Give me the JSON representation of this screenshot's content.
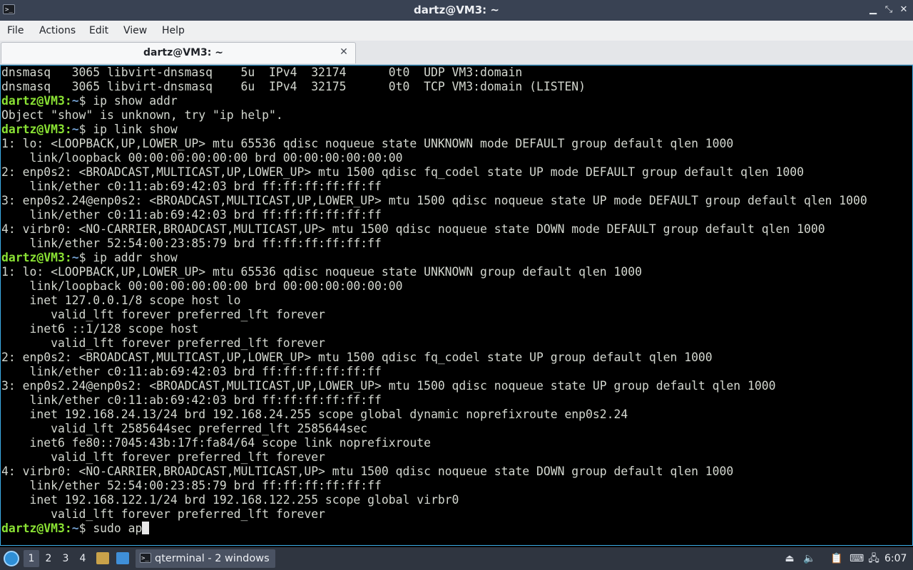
{
  "window": {
    "title": "dartz@VM3: ~",
    "controls": [
      "minimize",
      "restore",
      "close"
    ]
  },
  "menu": {
    "items": [
      "File",
      "Actions",
      "Edit",
      "View",
      "Help"
    ]
  },
  "tabs": [
    {
      "label": "dartz@VM3: ~",
      "close": "✕"
    }
  ],
  "terminal": {
    "prompt_user": "dartz@VM3",
    "prompt_sep": ":",
    "prompt_path": "~",
    "prompt_end": "$ ",
    "lines": [
      {
        "type": "out",
        "text": "dnsmasq   3065 libvirt-dnsmasq    5u  IPv4  32174      0t0  UDP VM3:domain"
      },
      {
        "type": "out",
        "text": "dnsmasq   3065 libvirt-dnsmasq    6u  IPv4  32175      0t0  TCP VM3:domain (LISTEN)"
      },
      {
        "type": "cmd",
        "text": "ip show addr"
      },
      {
        "type": "out",
        "text": "Object \"show\" is unknown, try \"ip help\"."
      },
      {
        "type": "cmd",
        "text": "ip link show"
      },
      {
        "type": "out",
        "text": "1: lo: <LOOPBACK,UP,LOWER_UP> mtu 65536 qdisc noqueue state UNKNOWN mode DEFAULT group default qlen 1000"
      },
      {
        "type": "out",
        "text": "    link/loopback 00:00:00:00:00:00 brd 00:00:00:00:00:00"
      },
      {
        "type": "out",
        "text": "2: enp0s2: <BROADCAST,MULTICAST,UP,LOWER_UP> mtu 1500 qdisc fq_codel state UP mode DEFAULT group default qlen 1000"
      },
      {
        "type": "out",
        "text": "    link/ether c0:11:ab:69:42:03 brd ff:ff:ff:ff:ff:ff"
      },
      {
        "type": "out",
        "text": "3: enp0s2.24@enp0s2: <BROADCAST,MULTICAST,UP,LOWER_UP> mtu 1500 qdisc noqueue state UP mode DEFAULT group default qlen 1000"
      },
      {
        "type": "out",
        "text": "    link/ether c0:11:ab:69:42:03 brd ff:ff:ff:ff:ff:ff"
      },
      {
        "type": "out",
        "text": "4: virbr0: <NO-CARRIER,BROADCAST,MULTICAST,UP> mtu 1500 qdisc noqueue state DOWN mode DEFAULT group default qlen 1000"
      },
      {
        "type": "out",
        "text": "    link/ether 52:54:00:23:85:79 brd ff:ff:ff:ff:ff:ff"
      },
      {
        "type": "cmd",
        "text": "ip addr show"
      },
      {
        "type": "out",
        "text": "1: lo: <LOOPBACK,UP,LOWER_UP> mtu 65536 qdisc noqueue state UNKNOWN group default qlen 1000"
      },
      {
        "type": "out",
        "text": "    link/loopback 00:00:00:00:00:00 brd 00:00:00:00:00:00"
      },
      {
        "type": "out",
        "text": "    inet 127.0.0.1/8 scope host lo"
      },
      {
        "type": "out",
        "text": "       valid_lft forever preferred_lft forever"
      },
      {
        "type": "out",
        "text": "    inet6 ::1/128 scope host"
      },
      {
        "type": "out",
        "text": "       valid_lft forever preferred_lft forever"
      },
      {
        "type": "out",
        "text": "2: enp0s2: <BROADCAST,MULTICAST,UP,LOWER_UP> mtu 1500 qdisc fq_codel state UP group default qlen 1000"
      },
      {
        "type": "out",
        "text": "    link/ether c0:11:ab:69:42:03 brd ff:ff:ff:ff:ff:ff"
      },
      {
        "type": "out",
        "text": "3: enp0s2.24@enp0s2: <BROADCAST,MULTICAST,UP,LOWER_UP> mtu 1500 qdisc noqueue state UP group default qlen 1000"
      },
      {
        "type": "out",
        "text": "    link/ether c0:11:ab:69:42:03 brd ff:ff:ff:ff:ff:ff"
      },
      {
        "type": "out",
        "text": "    inet 192.168.24.13/24 brd 192.168.24.255 scope global dynamic noprefixroute enp0s2.24"
      },
      {
        "type": "out",
        "text": "       valid_lft 2585644sec preferred_lft 2585644sec"
      },
      {
        "type": "out",
        "text": "    inet6 fe80::7045:43b:17f:fa84/64 scope link noprefixroute"
      },
      {
        "type": "out",
        "text": "       valid_lft forever preferred_lft forever"
      },
      {
        "type": "out",
        "text": "4: virbr0: <NO-CARRIER,BROADCAST,MULTICAST,UP> mtu 1500 qdisc noqueue state DOWN group default qlen 1000"
      },
      {
        "type": "out",
        "text": "    link/ether 52:54:00:23:85:79 brd ff:ff:ff:ff:ff:ff"
      },
      {
        "type": "out",
        "text": "    inet 192.168.122.1/24 brd 192.168.122.255 scope global virbr0"
      },
      {
        "type": "out",
        "text": "       valid_lft forever preferred_lft forever"
      },
      {
        "type": "input",
        "text": "sudo ap"
      }
    ]
  },
  "taskbar": {
    "desktops": [
      "1",
      "2",
      "3",
      "4"
    ],
    "active_desktop": "1",
    "task_label": "qterminal - 2 windows",
    "clock": "6:07"
  },
  "colors": {
    "titlebar_bg": "#394253",
    "terminal_bg": "#000000",
    "terminal_fg": "#d3d7cf",
    "prompt_user": "#8ae234",
    "prompt_path": "#729fcf",
    "focus_border": "#3daee9",
    "taskbar_bg": "#2f3540"
  },
  "icons": [
    "terminal-icon",
    "minimize-icon",
    "restore-icon",
    "close-icon",
    "lxqt-menu-icon",
    "file-manager-icon",
    "show-desktop-icon",
    "eject-icon",
    "volume-icon",
    "clipboard-icon",
    "keyboard-icon",
    "network-icon"
  ]
}
